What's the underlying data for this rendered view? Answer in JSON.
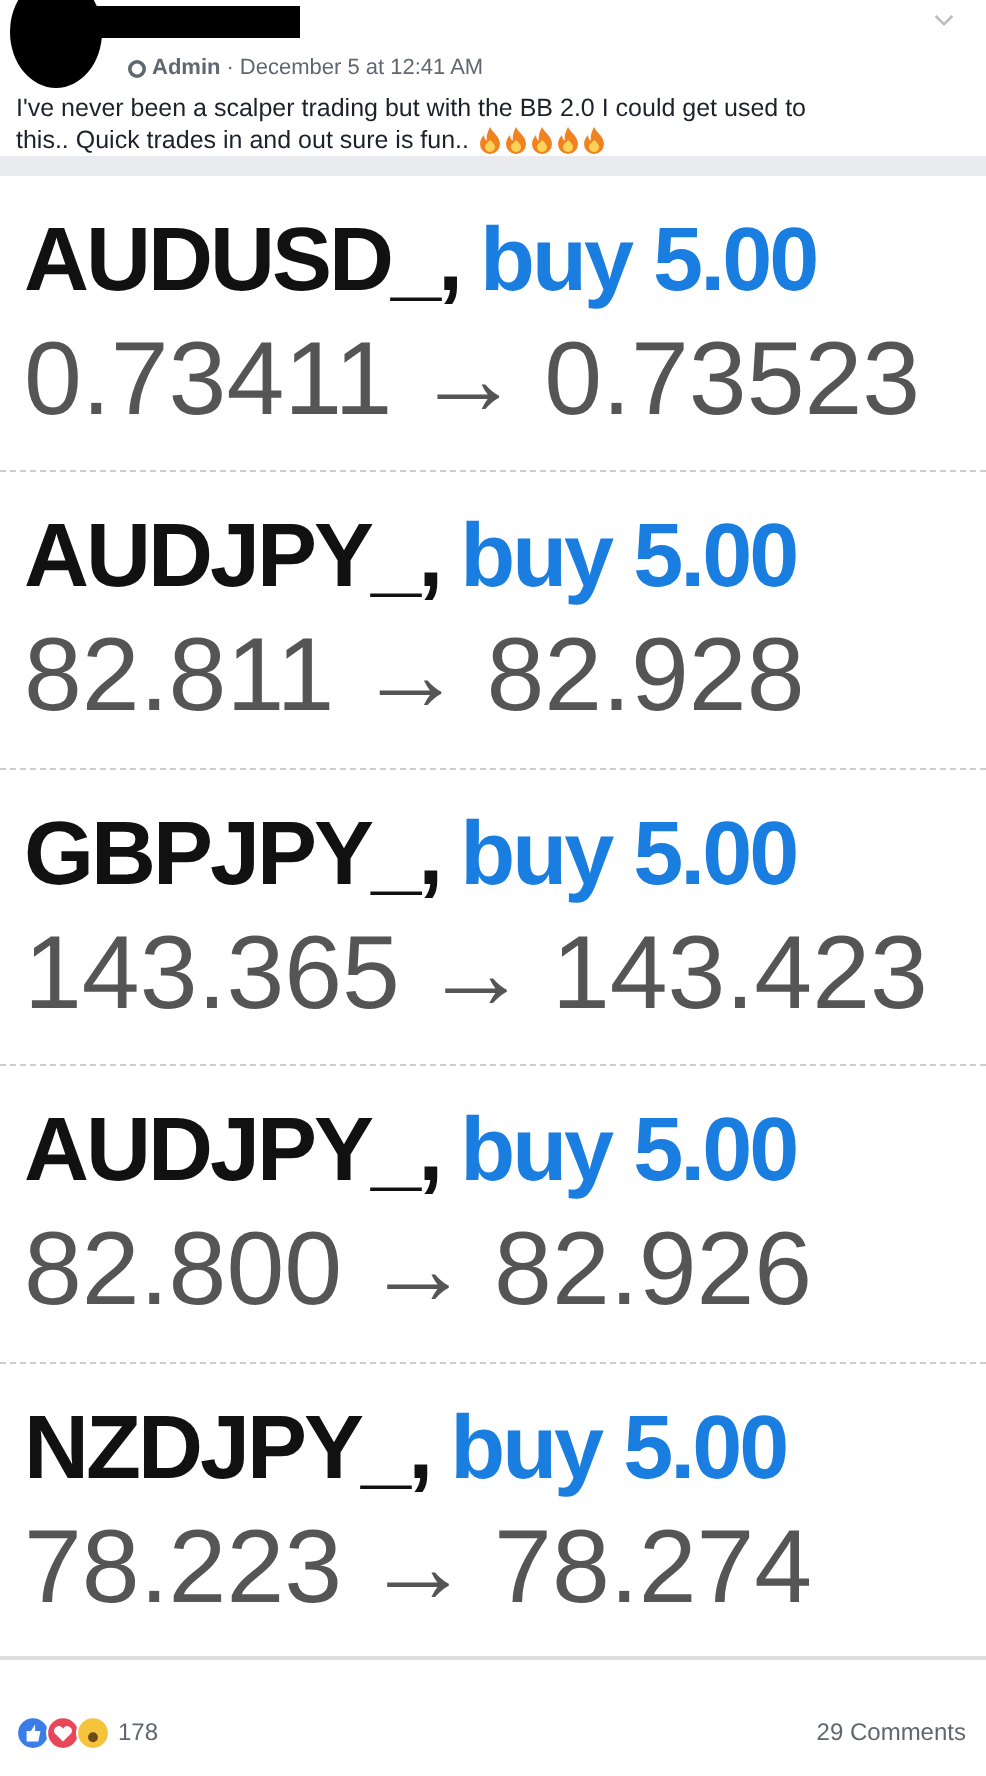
{
  "post": {
    "role": "Admin",
    "separator": "·",
    "time": "December 5 at 12:41 AM",
    "lines": [
      "I've never been a scalper trading but with the BB 2.0 I could get used to",
      "this.. Quick trades in and out sure is fun.."
    ]
  },
  "trades": [
    {
      "symbol": "AUDUSD_,",
      "side": "buy 5.00",
      "open": "0.73411",
      "arrow": "→",
      "close": "0.73523"
    },
    {
      "symbol": "AUDJPY_,",
      "side": "buy 5.00",
      "open": "82.811",
      "arrow": "→",
      "close": "82.928"
    },
    {
      "symbol": "GBPJPY_,",
      "side": "buy 5.00",
      "open": "143.365",
      "arrow": "→",
      "close": "143.423"
    },
    {
      "symbol": "AUDJPY_,",
      "side": "buy 5.00",
      "open": "82.800",
      "arrow": "→",
      "close": "82.926"
    },
    {
      "symbol": "NZDJPY_,",
      "side": "buy 5.00",
      "open": "78.223",
      "arrow": "→",
      "close": "78.274"
    }
  ],
  "footer": {
    "reaction_count": "178",
    "comments": "29 Comments"
  }
}
